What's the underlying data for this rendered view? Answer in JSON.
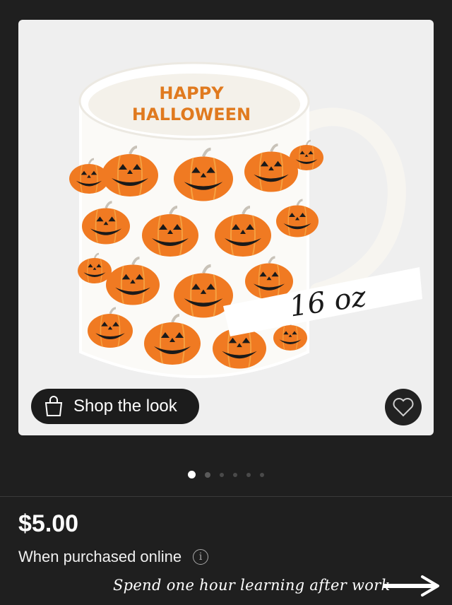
{
  "product": {
    "mug_text_line1": "HAPPY",
    "mug_text_line2": "HALLOWEEN",
    "size_label": "16 oz"
  },
  "actions": {
    "shop_label": "Shop the look"
  },
  "carousel": {
    "count": 6,
    "active_index": 0
  },
  "pricing": {
    "price": "$5.00",
    "note": "When purchased online",
    "info_glyph": "i"
  },
  "overlay": {
    "caption": "Spend one hour learning after work"
  },
  "colors": {
    "background": "#1f1f1f",
    "card": "#efefef",
    "pumpkin": "#f07a22",
    "accent_text": "#e07a1f"
  }
}
